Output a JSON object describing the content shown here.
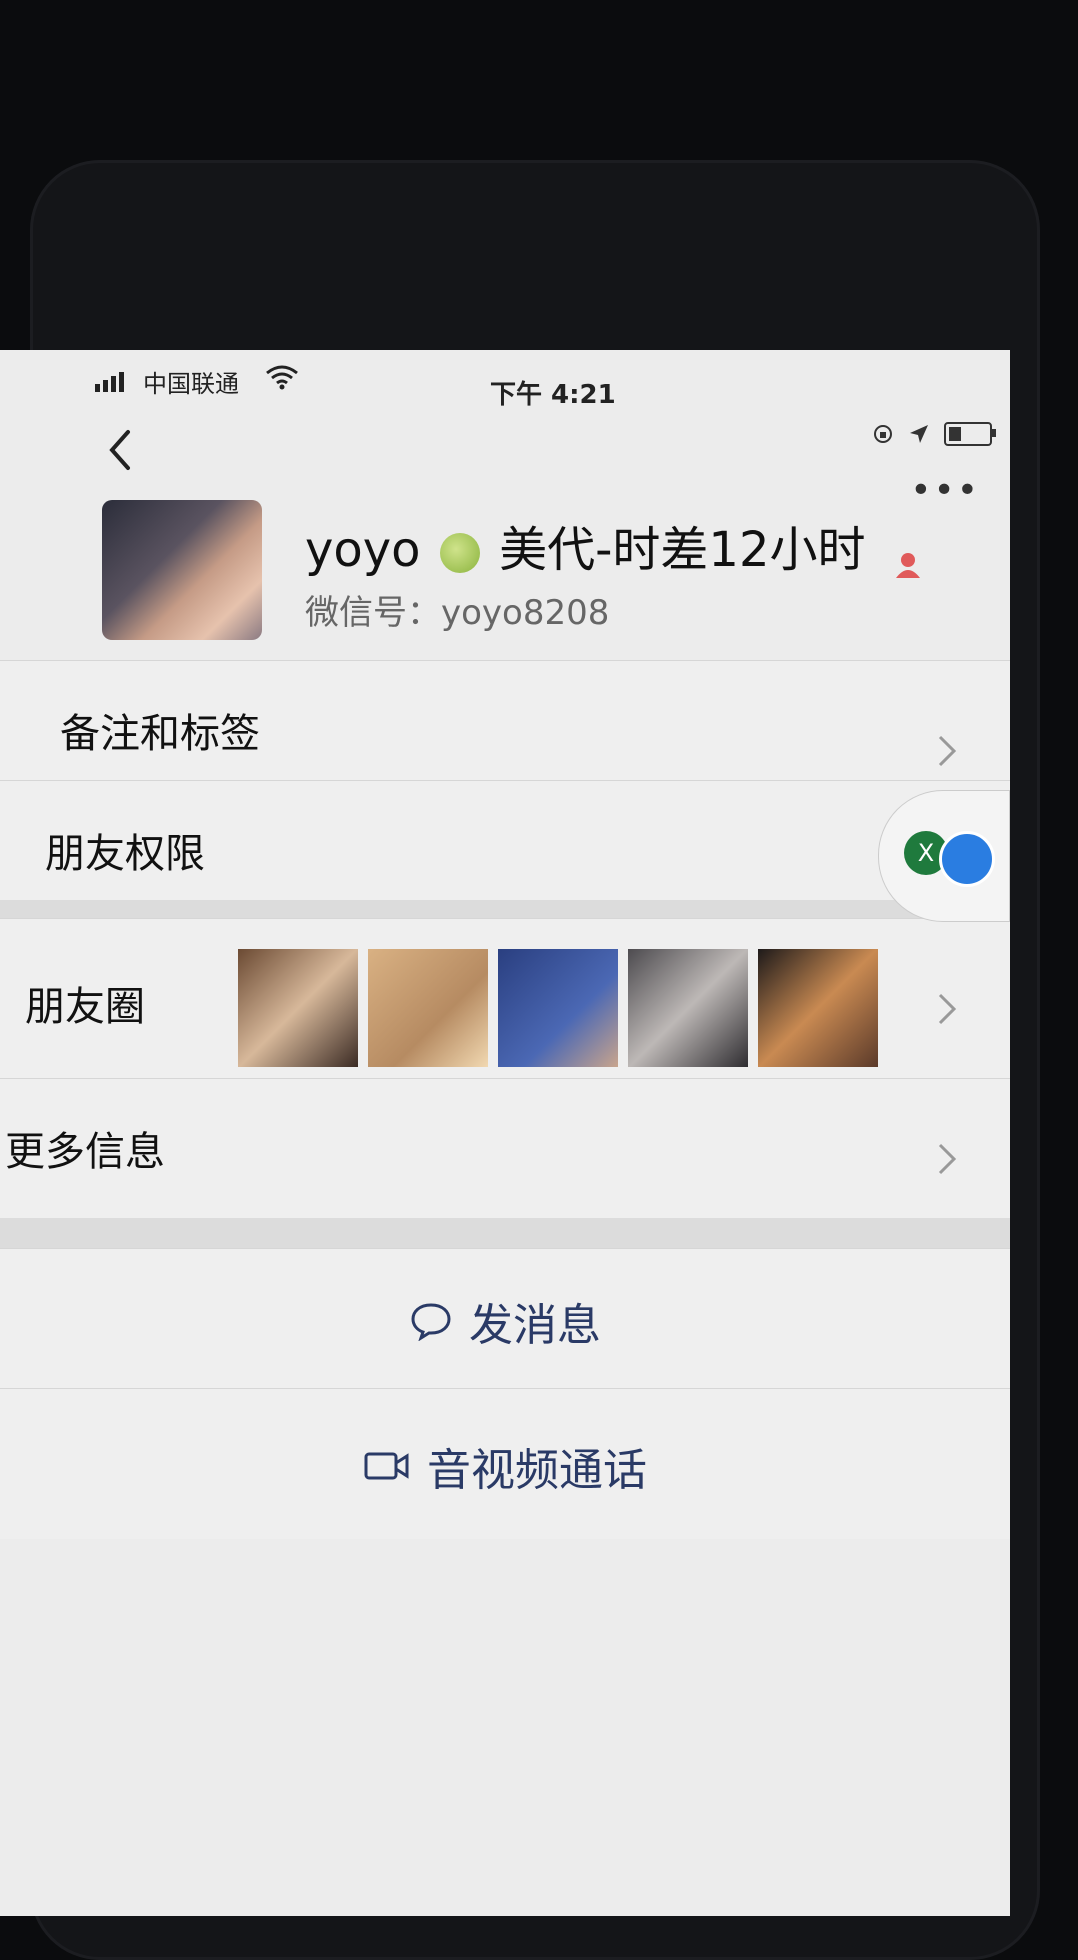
{
  "status_bar": {
    "carrier": "中国联通",
    "time": "下午 4:21"
  },
  "profile": {
    "name_prefix": "yoyo",
    "name_suffix": "美代-时差12小时",
    "wechat_id": "微信号：yoyo8208"
  },
  "rows": {
    "remarks_tags": "备注和标签",
    "friend_permissions": "朋友权限",
    "moments": "朋友圈",
    "more_info": "更多信息"
  },
  "actions": {
    "send_message": "发消息",
    "av_call": "音视频通话"
  },
  "floating": {
    "left_badge": "X"
  },
  "colors": {
    "action_text": "#2a3a66",
    "gender_icon": "#e05a5a"
  }
}
